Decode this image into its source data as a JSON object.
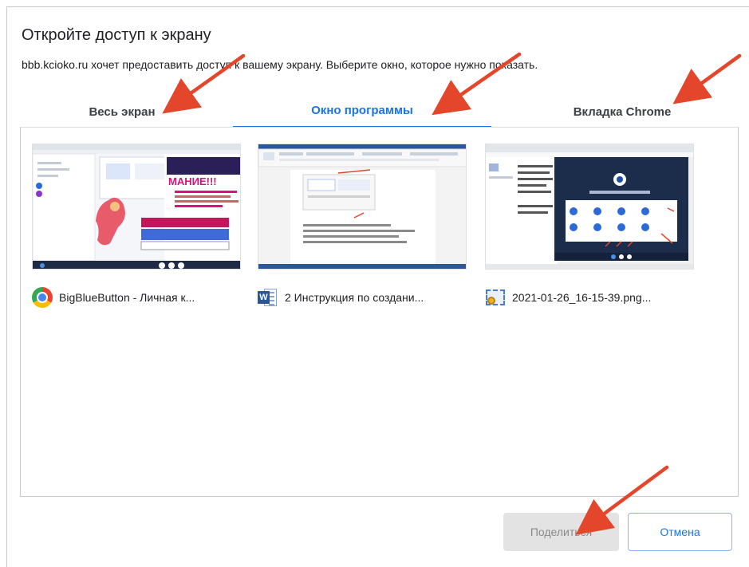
{
  "dialog": {
    "title": "Откройте доступ к экрану",
    "subtitle": "bbb.kcioko.ru хочет предоставить доступ к вашему экрану. Выберите окно, которое нужно показать."
  },
  "tabs": [
    {
      "label": "Весь экран",
      "active": false
    },
    {
      "label": "Окно программы",
      "active": true
    },
    {
      "label": "Вкладка Chrome",
      "active": false
    }
  ],
  "windows": [
    {
      "label": "BigBlueButton - Личная к...",
      "icon": "chrome-icon",
      "preview_text": "МАНИЕ!!!"
    },
    {
      "label": "2 Инструкция по создани...",
      "icon": "word-icon"
    },
    {
      "label": "2021-01-26_16-15-39.png...",
      "icon": "image-viewer-icon"
    }
  ],
  "buttons": {
    "share": "Поделиться",
    "cancel": "Отмена"
  },
  "colors": {
    "accent": "#1a73e8",
    "annotation_arrow": "#e3462a",
    "disabled_bg": "#e3e3e3"
  }
}
